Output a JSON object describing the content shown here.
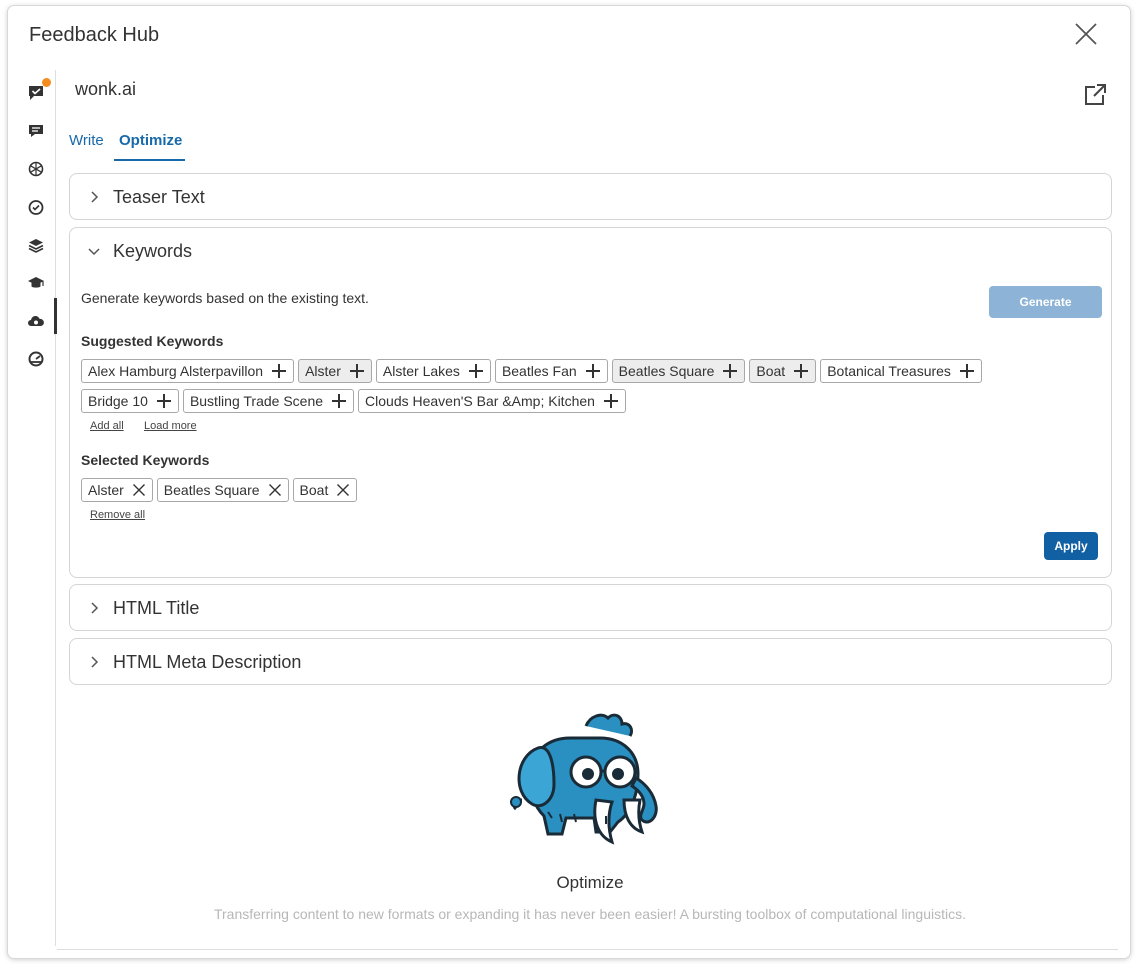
{
  "app": {
    "title": "Feedback Hub",
    "brand": "wonk.ai"
  },
  "tabs": [
    {
      "label": "Write",
      "active": false
    },
    {
      "label": "Optimize",
      "active": true
    }
  ],
  "sidebar": {
    "items": [
      {
        "icon": "chat-check-icon",
        "notification": true
      },
      {
        "icon": "comment-icon"
      },
      {
        "icon": "openai-icon"
      },
      {
        "icon": "clock-check-icon"
      },
      {
        "icon": "layers-icon"
      },
      {
        "icon": "graduation-cap-icon"
      },
      {
        "icon": "cloud-gear-icon",
        "active": true
      },
      {
        "icon": "gauge-icon"
      }
    ]
  },
  "panels": {
    "teaser": {
      "title": "Teaser Text",
      "expanded": false
    },
    "keywords": {
      "title": "Keywords",
      "expanded": true,
      "description": "Generate keywords based on the existing text.",
      "generate_label": "Generate",
      "suggested_label": "Suggested Keywords",
      "suggested_row1": [
        {
          "label": "Alex Hamburg Alsterpavillon",
          "highlighted": false
        },
        {
          "label": "Alster",
          "highlighted": true
        },
        {
          "label": "Alster Lakes",
          "highlighted": false
        },
        {
          "label": "Beatles Fan",
          "highlighted": false
        },
        {
          "label": "Beatles Square",
          "highlighted": true
        },
        {
          "label": "Boat",
          "highlighted": true
        },
        {
          "label": "Botanical Treasures",
          "highlighted": false
        }
      ],
      "suggested_row2": [
        {
          "label": "Bridge 10",
          "highlighted": false
        },
        {
          "label": "Bustling Trade Scene",
          "highlighted": false
        },
        {
          "label": "Clouds Heaven'S Bar &Amp; Kitchen",
          "highlighted": false
        }
      ],
      "add_all": "Add all",
      "load_more": "Load more",
      "selected_label": "Selected Keywords",
      "selected": [
        {
          "label": "Alster"
        },
        {
          "label": "Beatles Square"
        },
        {
          "label": "Boat"
        }
      ],
      "remove_all": "Remove all",
      "apply_label": "Apply"
    },
    "html_title": {
      "title": "HTML Title",
      "expanded": false
    },
    "meta_description": {
      "title": "HTML Meta Description",
      "expanded": false
    }
  },
  "empty_state": {
    "title": "Optimize",
    "description": "Transferring content to new formats or expanding it has never been easier! A bursting toolbox of computational linguistics."
  },
  "colors": {
    "accent": "#1769aa",
    "apply": "#1160a3",
    "generate_disabled": "#8db4d6",
    "notification": "#f28c1e",
    "mascot": "#2a8fc1"
  }
}
